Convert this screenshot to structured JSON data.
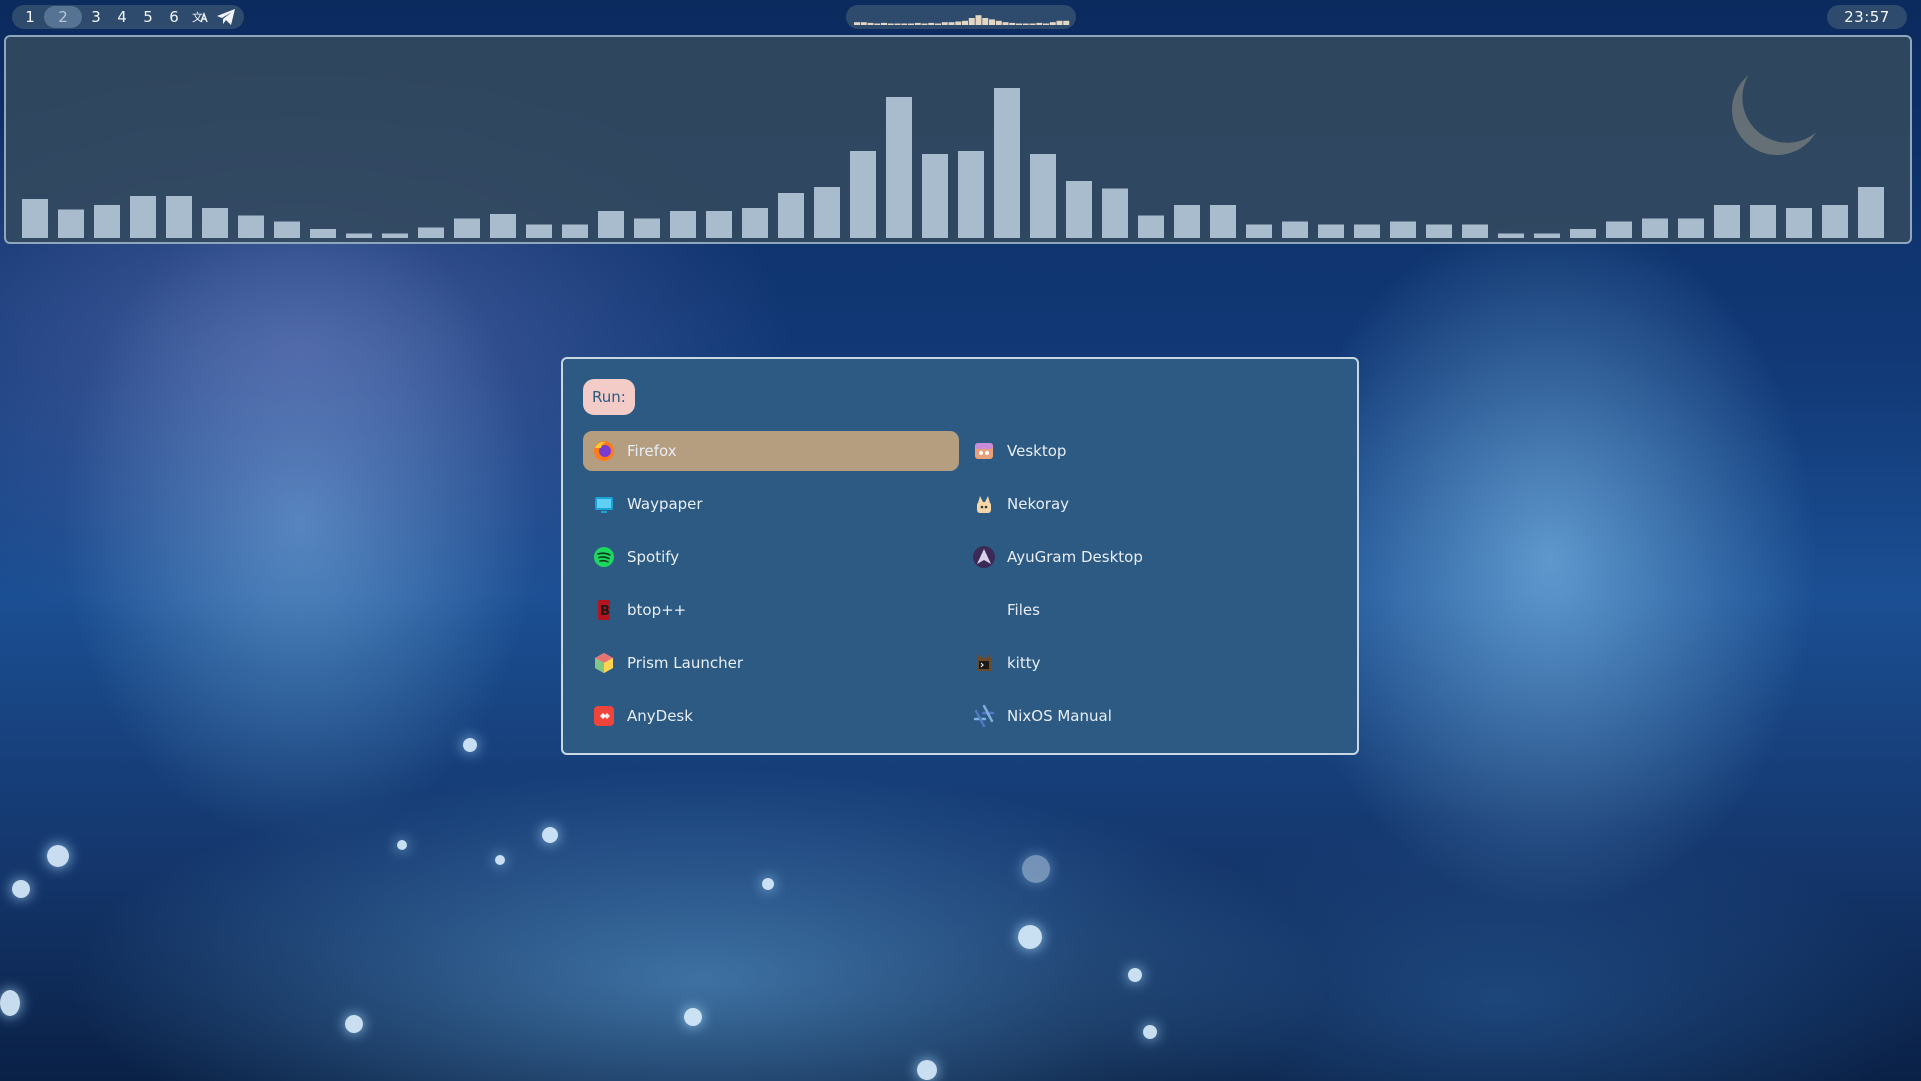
{
  "topbar": {
    "workspaces": [
      "1",
      "2",
      "3",
      "4",
      "5",
      "6"
    ],
    "active_workspace": "2",
    "tray_icons": [
      "translate-icon",
      "telegram-icon"
    ],
    "clock": "23:57"
  },
  "visualizer": {
    "levels": [
      0.26,
      0.19,
      0.22,
      0.28,
      0.28,
      0.2,
      0.15,
      0.11,
      0.06,
      0.03,
      0.03,
      0.07,
      0.13,
      0.16,
      0.09,
      0.09,
      0.18,
      0.13,
      0.18,
      0.18,
      0.2,
      0.3,
      0.34,
      0.58,
      0.94,
      0.56,
      0.58,
      1.0,
      0.56,
      0.38,
      0.33,
      0.15,
      0.22,
      0.22,
      0.09,
      0.11,
      0.09,
      0.09,
      0.11,
      0.09,
      0.09,
      0.03,
      0.03,
      0.06,
      0.11,
      0.13,
      0.13,
      0.22,
      0.22,
      0.2,
      0.22,
      0.34
    ]
  },
  "media_pill": {
    "levels": [
      0.2,
      0.2,
      0.15,
      0.1,
      0.15,
      0.1,
      0.1,
      0.1,
      0.1,
      0.15,
      0.1,
      0.15,
      0.1,
      0.2,
      0.2,
      0.25,
      0.3,
      0.5,
      0.7,
      0.5,
      0.4,
      0.3,
      0.2,
      0.15,
      0.1,
      0.1,
      0.1,
      0.15,
      0.1,
      0.2,
      0.3,
      0.3
    ]
  },
  "launcher": {
    "prompt": "Run:",
    "selected": "Firefox",
    "entries": [
      {
        "label": "Firefox",
        "icon": "firefox-icon"
      },
      {
        "label": "Vesktop",
        "icon": "vesktop-icon"
      },
      {
        "label": "Waypaper",
        "icon": "waypaper-icon"
      },
      {
        "label": "Nekoray",
        "icon": "nekoray-icon"
      },
      {
        "label": "Spotify",
        "icon": "spotify-icon"
      },
      {
        "label": "AyuGram Desktop",
        "icon": "ayugram-icon"
      },
      {
        "label": "btop++",
        "icon": "btop-icon"
      },
      {
        "label": "Files",
        "icon": "files-icon"
      },
      {
        "label": "Prism Launcher",
        "icon": "prism-launcher-icon"
      },
      {
        "label": "kitty",
        "icon": "kitty-icon"
      },
      {
        "label": "AnyDesk",
        "icon": "anydesk-icon"
      },
      {
        "label": "NixOS Manual",
        "icon": "nixos-icon"
      }
    ]
  }
}
